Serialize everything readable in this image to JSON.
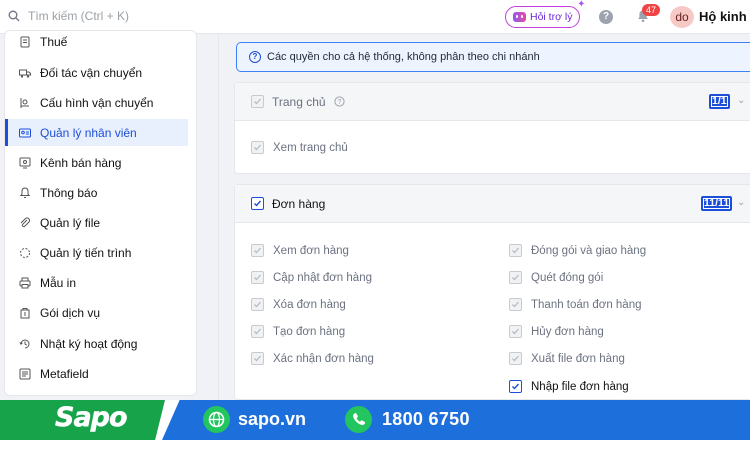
{
  "header": {
    "search_placeholder": "Tìm kiếm (Ctrl + K)",
    "help_label": "Hỏi trợ lý",
    "notification_count": "47",
    "avatar_initials": "do",
    "user_name": "Hộ kinh d"
  },
  "sidebar": {
    "items": [
      {
        "label": "Thuế",
        "icon": "receipt-icon"
      },
      {
        "label": "Đối tác vận chuyển",
        "icon": "truck-icon"
      },
      {
        "label": "Cấu hình vận chuyển",
        "icon": "shipping-config-icon"
      },
      {
        "label": "Quản lý nhân viên",
        "icon": "id-card-icon",
        "active": true
      },
      {
        "label": "Kênh bán hàng",
        "icon": "storefront-icon"
      },
      {
        "label": "Thông báo",
        "icon": "bell-icon"
      },
      {
        "label": "Quản lý file",
        "icon": "paperclip-icon"
      },
      {
        "label": "Quản lý tiến trình",
        "icon": "spinner-icon"
      },
      {
        "label": "Mẫu in",
        "icon": "printer-icon"
      },
      {
        "label": "Gói dịch vụ",
        "icon": "package-icon"
      },
      {
        "label": "Nhật ký hoạt động",
        "icon": "history-icon"
      },
      {
        "label": "Metafield",
        "icon": "list-icon"
      }
    ]
  },
  "main": {
    "info_text": "Các quyền cho cả hệ thống, không phân theo chi nhánh",
    "sections": [
      {
        "title": "Trang chủ",
        "count": "1/1",
        "enabled": false,
        "permissions": [
          "Xem trang chủ"
        ]
      },
      {
        "title": "Đơn hàng",
        "count": "11/11",
        "enabled": true,
        "permissions_left": [
          "Xem đơn hàng",
          "Cập nhật đơn hàng",
          "Xóa đơn hàng",
          "Tạo đơn hàng",
          "Xác nhận đơn hàng"
        ],
        "permissions_right": [
          "Đóng gói và giao hàng",
          "Quét đóng gói",
          "Thanh toán đơn hàng",
          "Hủy đơn hàng",
          "Xuất file đơn hàng",
          "Nhập file đơn hàng"
        ]
      }
    ]
  },
  "footer": {
    "brand": "Sapo",
    "website": "sapo.vn",
    "phone": "1800 6750"
  },
  "colors": {
    "accent": "#1d4ed8",
    "footer_green": "#16a34a",
    "footer_blue": "#1d6fdb",
    "badge_red": "#ef4444"
  }
}
